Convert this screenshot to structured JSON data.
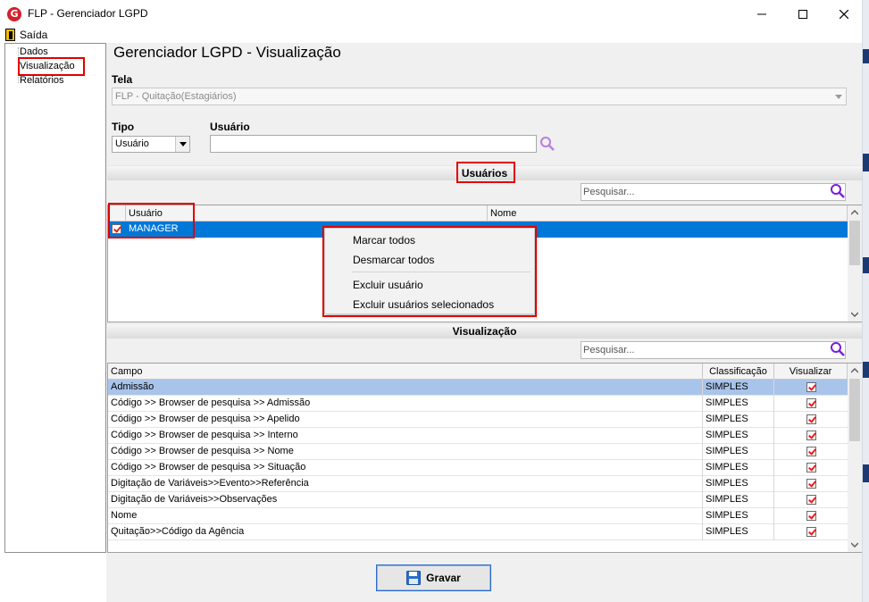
{
  "window": {
    "title": "FLP - Gerenciador LGPD",
    "app_icon_letter": "G",
    "controls": [
      "minimize-icon",
      "maximize-icon",
      "close-icon"
    ]
  },
  "menu": {
    "saida_label": "Saída"
  },
  "tree": {
    "items": [
      {
        "label": "Dados"
      },
      {
        "label": "Visualização"
      },
      {
        "label": "Relatórios"
      }
    ]
  },
  "page": {
    "title": "Gerenciador LGPD - Visualização"
  },
  "tela": {
    "label": "Tela",
    "value": "FLP - Quitação(Estagiários)"
  },
  "tipo": {
    "label": "Tipo",
    "value": "Usuário"
  },
  "usuario_field": {
    "label": "Usuário",
    "value": ""
  },
  "usuarios_section": {
    "title": "Usuários",
    "search_placeholder": "Pesquisar...",
    "columns": [
      "Usuário",
      "Nome"
    ],
    "rows": [
      {
        "usuario": "MANAGER",
        "nome": "",
        "checked": true
      }
    ]
  },
  "context_menu": {
    "items": [
      "Marcar todos",
      "Desmarcar todos",
      "Excluir usuário",
      "Excluir usuários selecionados"
    ]
  },
  "visualizacao_section": {
    "title": "Visualização",
    "search_placeholder": "Pesquisar...",
    "columns": [
      "Campo",
      "Classificação",
      "Visualizar"
    ],
    "rows": [
      {
        "campo": "Admissão",
        "classificacao": "SIMPLES",
        "visualizar": true
      },
      {
        "campo": "Código >> Browser de pesquisa >> Admissão",
        "classificacao": "SIMPLES",
        "visualizar": true
      },
      {
        "campo": "Código >> Browser de pesquisa >> Apelido",
        "classificacao": "SIMPLES",
        "visualizar": true
      },
      {
        "campo": "Código >> Browser de pesquisa >> Interno",
        "classificacao": "SIMPLES",
        "visualizar": true
      },
      {
        "campo": "Código >> Browser de pesquisa >> Nome",
        "classificacao": "SIMPLES",
        "visualizar": true
      },
      {
        "campo": "Código >> Browser de pesquisa >> Situação",
        "classificacao": "SIMPLES",
        "visualizar": true
      },
      {
        "campo": "Digitação de Variáveis>>Evento>>Referência",
        "classificacao": "SIMPLES",
        "visualizar": true
      },
      {
        "campo": "Digitação de Variáveis>>Observações",
        "classificacao": "SIMPLES",
        "visualizar": true
      },
      {
        "campo": "Nome",
        "classificacao": "SIMPLES",
        "visualizar": true
      },
      {
        "campo": "Quitação>>Código da Agência",
        "classificacao": "SIMPLES",
        "visualizar": true
      }
    ]
  },
  "footer": {
    "save_label": "Gravar"
  },
  "colors": {
    "selection": "#0078d7",
    "highlight_red": "#e10000",
    "search_icon": "#8a2be2",
    "first_row": "#a9c4eb"
  }
}
